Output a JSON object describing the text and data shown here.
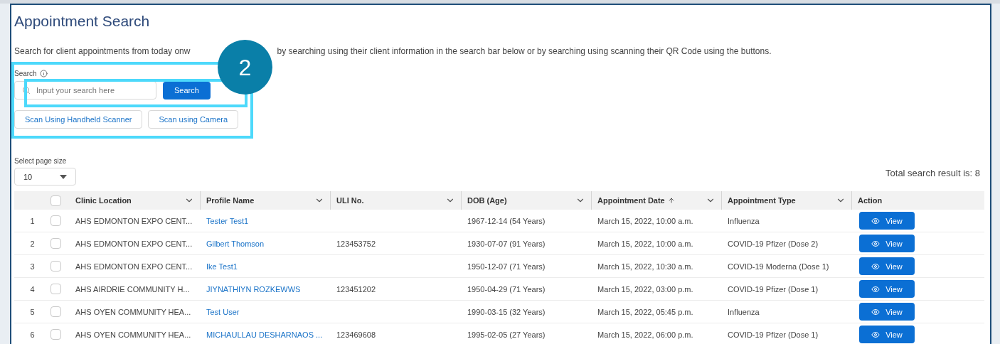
{
  "page_title": "Appointment Search",
  "description": [
    "Search for client appointments from today onw",
    "by searching using their client information in the search bar below or by searching using scanning their QR Code using the buttons."
  ],
  "step_badge": "2",
  "search": {
    "label": "Search",
    "placeholder": "Input your search here",
    "button": "Search"
  },
  "scan_buttons": [
    "Scan Using Handheld Scanner",
    "Scan using Camera"
  ],
  "page_size": {
    "label": "Select page size",
    "value": "10"
  },
  "total": "Total search result is: 8",
  "table": {
    "select_all_checked": false,
    "columns": [
      {
        "label": "Clinic Location",
        "sorted_ascending": false,
        "menu": true
      },
      {
        "label": "Profile Name",
        "sorted_ascending": false,
        "menu": true
      },
      {
        "label": "ULI No.",
        "sorted_ascending": false,
        "menu": true
      },
      {
        "label": "DOB (Age)",
        "sorted_ascending": false,
        "menu": true
      },
      {
        "label": "Appointment Date",
        "sorted_ascending": true,
        "menu": true
      },
      {
        "label": "Appointment Type",
        "sorted_ascending": false,
        "menu": true
      },
      {
        "label": "Action",
        "sorted_ascending": false,
        "menu": false
      }
    ],
    "rows": [
      {
        "index": "1",
        "checked": false,
        "clinic": "AHS EDMONTON EXPO CENT...",
        "name": "Tester Test1",
        "dob": "1967-12-14 (54 Years)",
        "date": "March 15, 2022, 10:00 a.m.",
        "type": "Influenza",
        "action": "View"
      },
      {
        "index": "2",
        "checked": false,
        "clinic": "AHS EDMONTON EXPO CENT...",
        "name": "Gilbert Thomson",
        "uli": "123453752",
        "dob": "1930-07-07 (91 Years)",
        "date": "March 15, 2022, 10:00 a.m.",
        "type": "COVID-19 Pfizer (Dose 2)",
        "action": "View"
      },
      {
        "index": "3",
        "checked": false,
        "clinic": "AHS EDMONTON EXPO CENT...",
        "name": "Ike Test1",
        "dob": "1950-12-07 (71 Years)",
        "date": "March 15, 2022, 10:30 a.m.",
        "type": "COVID-19 Moderna (Dose 1)",
        "action": "View"
      },
      {
        "index": "4",
        "checked": false,
        "clinic": "AHS AIRDRIE COMMUNITY H...",
        "name": "JIYNATHIYN ROZKEWWS",
        "uli": "123451202",
        "dob": "1950-04-29 (71 Years)",
        "date": "March 15, 2022, 03:00 p.m.",
        "type": "COVID-19 Pfizer (Dose 1)",
        "action": "View"
      },
      {
        "index": "5",
        "checked": false,
        "clinic": "AHS OYEN COMMUNITY HEA...",
        "name": "Test User",
        "dob": "1990-03-15 (32 Years)",
        "date": "March 15, 2022, 05:45 p.m.",
        "type": "Influenza",
        "action": "View"
      },
      {
        "index": "6",
        "checked": false,
        "clinic": "AHS OYEN COMMUNITY HEA...",
        "name": "MICHAULLAU DESHARNAOS ...",
        "uli": "123469608",
        "dob": "1995-02-05 (27 Years)",
        "date": "March 15, 2022, 06:00 p.m.",
        "type": "COVID-19 Pfizer (Dose 1)",
        "action": "View"
      }
    ]
  }
}
